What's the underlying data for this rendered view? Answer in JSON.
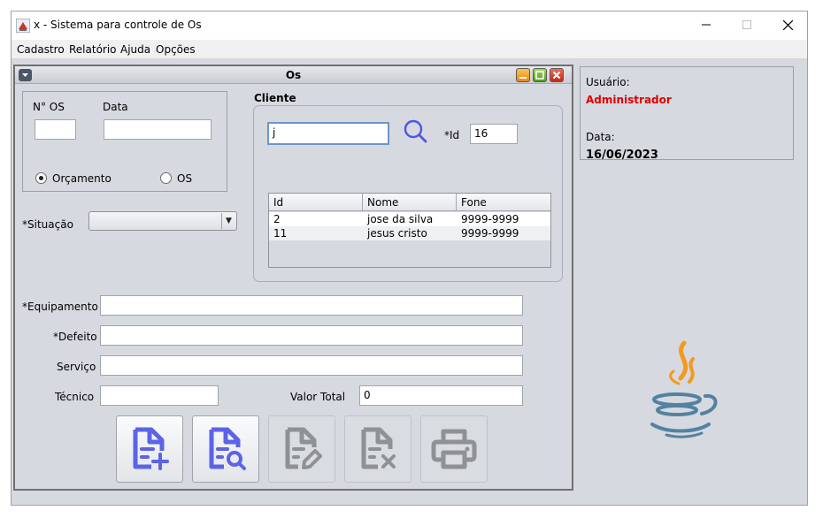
{
  "window": {
    "title": "x - Sistema para controle de Os",
    "minimize_icon": "minimize-icon",
    "maximize_icon": "maximize-icon",
    "close_icon": "close-icon"
  },
  "menu": [
    "Cadastro",
    "Relatório",
    "Ajuda",
    "Opções"
  ],
  "internal_frame": {
    "title": "Os",
    "os_box": {
      "num_label": "N° OS",
      "num_value": "",
      "date_label": "Data",
      "date_value": "",
      "radio_orcamento": "Orçamento",
      "radio_os": "OS",
      "selected": "Orçamento"
    },
    "situacao_label": "*Situação",
    "situacao_value": "",
    "cliente": {
      "title": "Cliente",
      "search_value": "j",
      "id_label": "*Id",
      "id_value": "16",
      "columns": [
        "Id",
        "Nome",
        "Fone"
      ],
      "rows": [
        [
          "2",
          "jose da silva",
          "9999-9999"
        ],
        [
          "11",
          "jesus cristo",
          "9999-9999"
        ]
      ]
    },
    "equipamento_label": "*Equipamento",
    "equipamento_value": "",
    "defeito_label": "*Defeito",
    "defeito_value": "",
    "servico_label": "Serviço",
    "servico_value": "",
    "tecnico_label": "Técnico",
    "tecnico_value": "",
    "valor_total_label": "Valor Total",
    "valor_total_value": "0",
    "buttons": [
      {
        "icon": "file-add-icon",
        "enabled": true
      },
      {
        "icon": "file-search-icon",
        "enabled": true
      },
      {
        "icon": "file-edit-icon",
        "enabled": false
      },
      {
        "icon": "file-delete-icon",
        "enabled": false
      },
      {
        "icon": "printer-icon",
        "enabled": false
      }
    ]
  },
  "side": {
    "user_label": "Usuário:",
    "user_value": "Administrador",
    "date_label": "Data:",
    "date_value": "16/06/2023"
  },
  "colors": {
    "accent_icon": "#5c63e6",
    "disabled_icon": "#8e9196",
    "user_name": "#e00000",
    "search_icon": "#4f56e6"
  }
}
